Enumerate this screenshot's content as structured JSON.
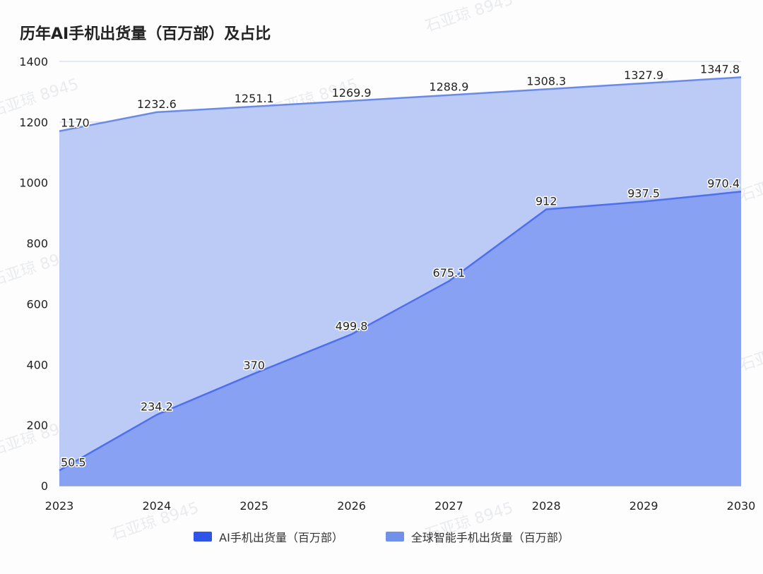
{
  "colors": {
    "ai_line": "#4e6ff0",
    "ai_fill": "#88a1f2",
    "ai_swatch": "#2f55e8",
    "global_line": "#6a8ae8",
    "global_fill": "#bccbf6",
    "global_swatch": "#7090ea",
    "grid": "#c9d2ea"
  },
  "watermark": "石亚琼 8945",
  "chart_data": {
    "type": "area",
    "title": "历年AI手机出货量（百万部）及占比",
    "categories": [
      "2023",
      "2024",
      "2025",
      "2026",
      "2027",
      "2028",
      "2029",
      "2030"
    ],
    "ylim": [
      0,
      1400
    ],
    "yticks": [
      0,
      200,
      400,
      600,
      800,
      1000,
      1200,
      1400
    ],
    "grid": true,
    "legend_position": "bottom",
    "series": [
      {
        "name": "AI手机出货量（百万部）",
        "values": [
          50.5,
          234.2,
          370,
          499.8,
          675.1,
          912,
          937.5,
          970.4
        ],
        "labels": [
          "50.5",
          "234.2",
          "370",
          "499.8",
          "675.1",
          "912",
          "937.5",
          "970.4"
        ]
      },
      {
        "name": "全球智能手机出货量（百万部）",
        "values": [
          1170,
          1232.6,
          1251.1,
          1269.9,
          1288.9,
          1308.3,
          1327.9,
          1347.8
        ],
        "labels": [
          "1170",
          "1232.6",
          "1251.1",
          "1269.9",
          "1288.9",
          "1308.3",
          "1327.9",
          "1347.8"
        ]
      }
    ]
  }
}
